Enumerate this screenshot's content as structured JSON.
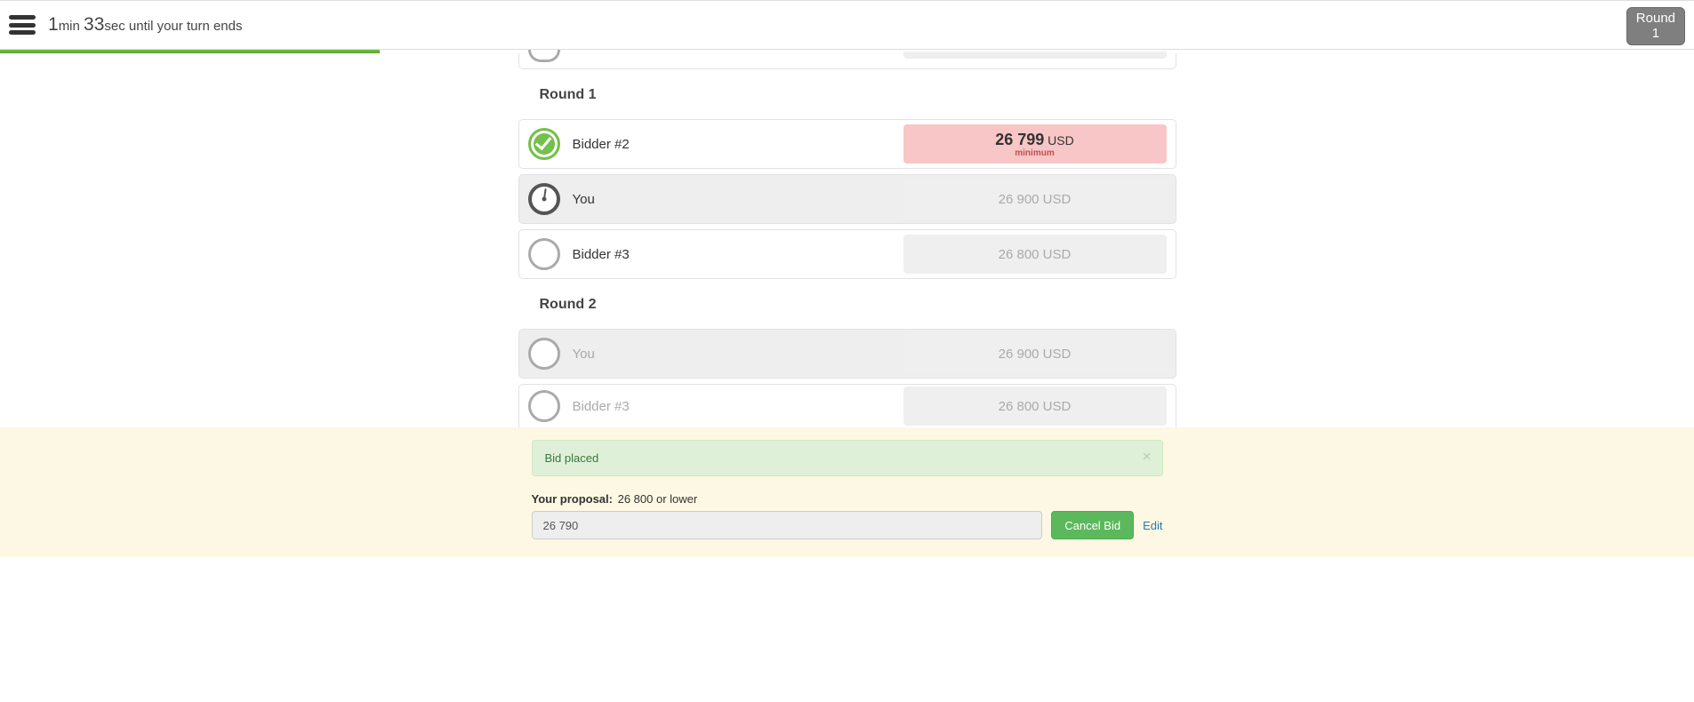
{
  "header": {
    "timer_min_value": "1",
    "timer_min_label": "min ",
    "timer_sec_value": "33",
    "timer_sec_label": "sec ",
    "timer_suffix": "until your turn ends",
    "badge_label": "Round",
    "badge_value": "1",
    "progress_percent": 22.4
  },
  "rounds": [
    {
      "heading": "Round 1",
      "rows": [
        {
          "name": "Bidder #2",
          "amount_value": "26 799",
          "amount_currency": "USD",
          "is_minimum": true,
          "minimum_label": "minimum",
          "icon": "check",
          "highlight": false,
          "faded": false
        },
        {
          "name": "You",
          "amount_text": "26 900 USD",
          "is_minimum": false,
          "icon": "clock",
          "highlight": true,
          "faded": false
        },
        {
          "name": "Bidder #3",
          "amount_text": "26 800 USD",
          "is_minimum": false,
          "icon": "empty",
          "highlight": false,
          "faded": false
        }
      ]
    },
    {
      "heading": "Round 2",
      "rows": [
        {
          "name": "You",
          "amount_text": "26 900 USD",
          "is_minimum": false,
          "icon": "empty",
          "highlight": true,
          "faded": true
        },
        {
          "name": "Bidder #3",
          "amount_text": "26 800 USD",
          "is_minimum": false,
          "icon": "empty",
          "highlight": false,
          "faded": true
        }
      ]
    }
  ],
  "footer": {
    "alert_text": "Bid placed",
    "proposal_label": "Your proposal:",
    "proposal_hint": "26 800 or lower",
    "input_value": "26 790",
    "cancel_label": "Cancel Bid",
    "edit_label": "Edit"
  }
}
